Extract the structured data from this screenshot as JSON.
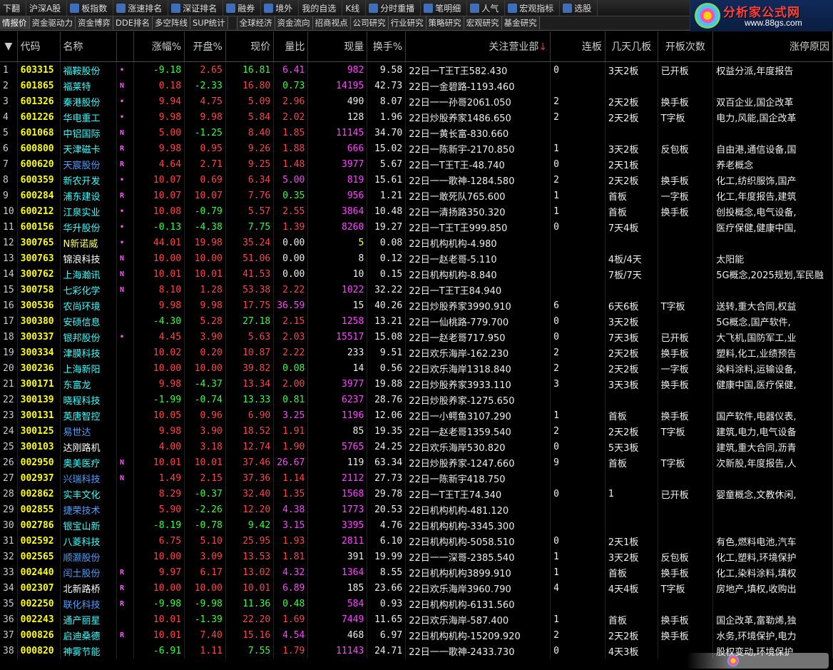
{
  "toolbar": {
    "items": [
      {
        "label": "下翻",
        "icon": ""
      },
      {
        "label": "沪深A股",
        "icon": ""
      },
      {
        "label": "板指数",
        "icon": "chart-icon"
      },
      {
        "label": "涨速排名",
        "icon": "speed-icon"
      },
      {
        "label": "深证排名",
        "icon": "rank-icon"
      },
      {
        "label": "融券",
        "icon": "r-icon"
      },
      {
        "label": "境外",
        "icon": "globe-icon"
      },
      {
        "label": "我的自选",
        "icon": ""
      },
      {
        "label": "K线",
        "icon": ""
      },
      {
        "label": "分时重播",
        "icon": "replay-icon"
      },
      {
        "label": "笔明细",
        "icon": "detail-icon"
      },
      {
        "label": "人气",
        "icon": "people-icon"
      },
      {
        "label": "宏观指标",
        "icon": "macro-icon"
      },
      {
        "label": "选股",
        "icon": "pick-icon"
      }
    ]
  },
  "brand": {
    "name": "分析家公式网",
    "url": "www.88gs.com"
  },
  "tabs": {
    "left": [
      "情报价",
      "资金驱动力",
      "资金博弈",
      "DDE排名",
      "多空阵线",
      "SUP统计"
    ],
    "right": [
      "全球经济",
      "资金流向",
      "招商视点",
      "公司研究",
      "行业研究",
      "策略研究",
      "宏观研究",
      "基金研究"
    ]
  },
  "table": {
    "headers": {
      "code": "代码",
      "name": "名称",
      "pct": "涨幅%",
      "open_pct": "开盘%",
      "price": "现价",
      "vol_ratio": "量比",
      "cur_vol": "现量",
      "turnover": "换手%",
      "broker": "关注营业部",
      "consec": "连板",
      "days": "几天几板",
      "open_times": "开板次数",
      "reason": "涨停原因"
    },
    "sort_marker": "↓",
    "rows": [
      {
        "idx": "1",
        "code": "603315",
        "name": "福鞍股份",
        "nc": "cyan",
        "flag": "•",
        "pct": "-9.18",
        "open_pct": "2.65",
        "price": "16.81",
        "vol_ratio": "6.41",
        "vr_c": "mag",
        "cur_vol": "982",
        "cv_c": "mag",
        "turnover": "9.58",
        "broker": "22日一T王T王582.430",
        "consec": "0",
        "days": "3天2板",
        "open_times": "已开板",
        "reason": "权益分派,年度报告"
      },
      {
        "idx": "2",
        "code": "601865",
        "name": "福莱特",
        "nc": "cyan",
        "flag": "N",
        "pct": "0.18",
        "open_pct": "-2.33",
        "price": "16.80",
        "vol_ratio": "0.73",
        "vr_c": "dn",
        "cur_vol": "14195",
        "cv_c": "mag",
        "turnover": "42.73",
        "broker": "22日一金碧路-1193.460",
        "consec": "",
        "days": "",
        "open_times": "",
        "reason": ""
      },
      {
        "idx": "3",
        "code": "601326",
        "name": "秦港股份",
        "nc": "cyan",
        "flag": "•",
        "pct": "9.94",
        "open_pct": "4.75",
        "price": "5.09",
        "vol_ratio": "2.96",
        "vr_c": "up",
        "cur_vol": "490",
        "cv_c": "wht",
        "turnover": "8.07",
        "broker": "22日一一孙哥2061.050",
        "consec": "2",
        "days": "2天2板",
        "open_times": "换手板",
        "reason": "双百企业,国企改革"
      },
      {
        "idx": "4",
        "code": "601226",
        "name": "华电重工",
        "nc": "cyan",
        "flag": "•",
        "pct": "9.98",
        "open_pct": "9.98",
        "price": "5.84",
        "vol_ratio": "2.02",
        "vr_c": "up",
        "cur_vol": "128",
        "cv_c": "wht",
        "turnover": "1.96",
        "broker": "22日炒股养家1486.650",
        "consec": "2",
        "days": "2天2板",
        "open_times": "T字板",
        "reason": "电力,风能,国企改革"
      },
      {
        "idx": "5",
        "code": "601068",
        "name": "中铝国际",
        "nc": "cyan",
        "flag": "N",
        "pct": "5.00",
        "open_pct": "-1.25",
        "price": "8.40",
        "vol_ratio": "1.85",
        "vr_c": "up",
        "cur_vol": "11145",
        "cv_c": "mag",
        "turnover": "34.70",
        "broker": "22日一黄长富-830.660",
        "consec": "",
        "days": "",
        "open_times": "",
        "reason": ""
      },
      {
        "idx": "6",
        "code": "600800",
        "name": "天津磁卡",
        "nc": "cyan",
        "flag": "R",
        "pct": "9.98",
        "open_pct": "0.95",
        "price": "9.26",
        "vol_ratio": "1.88",
        "vr_c": "up",
        "cur_vol": "666",
        "cv_c": "mag",
        "turnover": "15.02",
        "broker": "22日一陈新宇-2170.850",
        "consec": "1",
        "days": "3天2板",
        "open_times": "反包板",
        "reason": "自由港,通信设备,国"
      },
      {
        "idx": "7",
        "code": "600620",
        "name": "天宸股份",
        "nc": "blue",
        "flag": "R",
        "pct": "4.64",
        "open_pct": "2.71",
        "price": "9.25",
        "vol_ratio": "1.48",
        "vr_c": "up",
        "cur_vol": "3977",
        "cv_c": "mag",
        "turnover": "5.67",
        "broker": "22日一T王T王-48.740",
        "consec": "0",
        "days": "2天1板",
        "open_times": "",
        "reason": "养老概念"
      },
      {
        "idx": "8",
        "code": "600359",
        "name": "新农开发",
        "nc": "cyan",
        "flag": "•",
        "pct": "10.07",
        "open_pct": "0.69",
        "price": "6.34",
        "vol_ratio": "5.00",
        "vr_c": "mag",
        "cur_vol": "819",
        "cv_c": "mag",
        "turnover": "15.61",
        "broker": "22日一一歌神-1284.580",
        "consec": "2",
        "days": "2天2板",
        "open_times": "换手板",
        "reason": "化工,纺织服饰,国产"
      },
      {
        "idx": "9",
        "code": "600284",
        "name": "浦东建设",
        "nc": "cyan",
        "flag": "R",
        "pct": "10.07",
        "open_pct": "10.07",
        "price": "7.76",
        "vol_ratio": "0.35",
        "vr_c": "dn",
        "cur_vol": "956",
        "cv_c": "mag",
        "turnover": "1.21",
        "broker": "22日一敢死队765.600",
        "consec": "1",
        "days": "首板",
        "open_times": "一字板",
        "reason": "化工,年度报告,建筑"
      },
      {
        "idx": "10",
        "code": "600212",
        "name": "江泉实业",
        "nc": "cyan",
        "flag": "•",
        "pct": "10.08",
        "open_pct": "-0.79",
        "price": "5.57",
        "vol_ratio": "2.55",
        "vr_c": "up",
        "cur_vol": "3864",
        "cv_c": "mag",
        "turnover": "10.48",
        "broker": "22日一清扬路350.320",
        "consec": "1",
        "days": "首板",
        "open_times": "换手板",
        "reason": "创投概念,电气设备,"
      },
      {
        "idx": "11",
        "code": "600156",
        "name": "华升股份",
        "nc": "cyan",
        "flag": "•",
        "pct": "-0.13",
        "open_pct": "-4.38",
        "price": "7.75",
        "vol_ratio": "1.39",
        "vr_c": "up",
        "cur_vol": "8260",
        "cv_c": "mag",
        "turnover": "19.27",
        "broker": "22日一T王T王999.850",
        "consec": "0",
        "days": "7天4板",
        "open_times": "",
        "reason": "医疗保健,健康中国,"
      },
      {
        "idx": "12",
        "code": "300765",
        "name": "N新诺威",
        "nc": "yel",
        "flag": "•",
        "pct": "44.01",
        "open_pct": "19.98",
        "price": "35.24",
        "vol_ratio": "0.00",
        "vr_c": "wht",
        "cur_vol": "5",
        "cv_c": "yel",
        "turnover": "0.08",
        "broker": "22日机构机构-4.980",
        "consec": "",
        "days": "",
        "open_times": "",
        "reason": ""
      },
      {
        "idx": "13",
        "code": "300763",
        "name": "锦浪科技",
        "nc": "wht",
        "flag": "N",
        "pct": "10.00",
        "open_pct": "10.00",
        "price": "51.06",
        "vol_ratio": "0.00",
        "vr_c": "wht",
        "cur_vol": "8",
        "cv_c": "wht",
        "turnover": "0.12",
        "broker": "22日一赵老哥-5.110",
        "consec": "",
        "days": "4板/4天",
        "open_times": "",
        "reason": "太阳能"
      },
      {
        "idx": "14",
        "code": "300762",
        "name": "上海瀚讯",
        "nc": "cyan",
        "flag": "N",
        "pct": "10.01",
        "open_pct": "10.01",
        "price": "41.53",
        "vol_ratio": "0.00",
        "vr_c": "wht",
        "cur_vol": "10",
        "cv_c": "wht",
        "turnover": "0.15",
        "broker": "22日机构机构-8.840",
        "consec": "",
        "days": "7板/7天",
        "open_times": "",
        "reason": "5G概念,2025规划,军民融"
      },
      {
        "idx": "15",
        "code": "300758",
        "name": "七彩化学",
        "nc": "cyan",
        "flag": "N",
        "pct": "8.10",
        "open_pct": "1.28",
        "price": "53.38",
        "vol_ratio": "2.22",
        "vr_c": "up",
        "cur_vol": "1022",
        "cv_c": "mag",
        "turnover": "32.22",
        "broker": "22日一T王T王84.940",
        "consec": "",
        "days": "",
        "open_times": "",
        "reason": ""
      },
      {
        "idx": "16",
        "code": "300536",
        "name": "农尚环境",
        "nc": "cyan",
        "flag": "",
        "pct": "9.98",
        "open_pct": "9.98",
        "price": "17.75",
        "vol_ratio": "36.59",
        "vr_c": "mag",
        "cur_vol": "15",
        "cv_c": "wht",
        "turnover": "40.26",
        "broker": "22日炒股养家3990.910",
        "consec": "6",
        "days": "6天6板",
        "open_times": "T字板",
        "reason": "送转,重大合同,权益"
      },
      {
        "idx": "17",
        "code": "300380",
        "name": "安硕信息",
        "nc": "cyan",
        "flag": "",
        "pct": "-4.30",
        "open_pct": "5.28",
        "price": "27.18",
        "vol_ratio": "2.15",
        "vr_c": "up",
        "cur_vol": "1258",
        "cv_c": "mag",
        "turnover": "13.21",
        "broker": "22日一仙桃路-779.700",
        "consec": "0",
        "days": "3天2板",
        "open_times": "",
        "reason": "5G概念,国产软件,"
      },
      {
        "idx": "18",
        "code": "300337",
        "name": "银邦股份",
        "nc": "cyan",
        "flag": "•",
        "pct": "4.45",
        "open_pct": "3.90",
        "price": "5.63",
        "vol_ratio": "2.03",
        "vr_c": "up",
        "cur_vol": "15517",
        "cv_c": "mag",
        "turnover": "15.08",
        "broker": "22日一赵老哥717.950",
        "consec": "0",
        "days": "7天3板",
        "open_times": "已开板",
        "reason": "大飞机,国防军工,业"
      },
      {
        "idx": "19",
        "code": "300334",
        "name": "津膜科技",
        "nc": "cyan",
        "flag": "",
        "pct": "10.02",
        "open_pct": "0.20",
        "price": "10.87",
        "vol_ratio": "2.22",
        "vr_c": "up",
        "cur_vol": "233",
        "cv_c": "wht",
        "turnover": "9.51",
        "broker": "22日欢乐海岸-162.230",
        "consec": "2",
        "days": "2天2板",
        "open_times": "换手板",
        "reason": "塑料,化工,业绩预告"
      },
      {
        "idx": "20",
        "code": "300236",
        "name": "上海新阳",
        "nc": "cyan",
        "flag": "",
        "pct": "10.00",
        "open_pct": "10.00",
        "price": "39.82",
        "vol_ratio": "0.08",
        "vr_c": "dn",
        "cur_vol": "14",
        "cv_c": "wht",
        "turnover": "0.56",
        "broker": "22日欢乐海岸1318.840",
        "consec": "2",
        "days": "2天2板",
        "open_times": "一字板",
        "reason": "染料涂料,运输设备,"
      },
      {
        "idx": "21",
        "code": "300171",
        "name": "东富龙",
        "nc": "cyan",
        "flag": "",
        "pct": "9.98",
        "open_pct": "-4.37",
        "price": "13.34",
        "vol_ratio": "2.00",
        "vr_c": "up",
        "cur_vol": "3977",
        "cv_c": "mag",
        "turnover": "19.88",
        "broker": "22日炒股养家3933.110",
        "consec": "3",
        "days": "3天3板",
        "open_times": "换手板",
        "reason": "健康中国,医疗保健,"
      },
      {
        "idx": "22",
        "code": "300139",
        "name": "晓程科技",
        "nc": "cyan",
        "flag": "",
        "pct": "-1.99",
        "open_pct": "-0.74",
        "price": "13.33",
        "vol_ratio": "0.81",
        "vr_c": "dn",
        "cur_vol": "6237",
        "cv_c": "mag",
        "turnover": "28.76",
        "broker": "22日炒股养家-1275.650",
        "consec": "",
        "days": "",
        "open_times": "",
        "reason": ""
      },
      {
        "idx": "23",
        "code": "300131",
        "name": "英唐智控",
        "nc": "cyan",
        "flag": "",
        "pct": "10.05",
        "open_pct": "0.96",
        "price": "6.90",
        "vol_ratio": "3.25",
        "vr_c": "mag",
        "cur_vol": "1196",
        "cv_c": "mag",
        "turnover": "12.06",
        "broker": "22日一小鳄鱼3107.290",
        "consec": "1",
        "days": "首板",
        "open_times": "换手板",
        "reason": "国产软件,电器仪表,"
      },
      {
        "idx": "24",
        "code": "300125",
        "name": "易世达",
        "nc": "blue",
        "flag": "",
        "pct": "9.98",
        "open_pct": "3.90",
        "price": "18.52",
        "vol_ratio": "1.91",
        "vr_c": "up",
        "cur_vol": "85",
        "cv_c": "wht",
        "turnover": "19.35",
        "broker": "22日一赵老哥1359.540",
        "consec": "2",
        "days": "2天2板",
        "open_times": "T字板",
        "reason": "建筑,电力,电气设备"
      },
      {
        "idx": "25",
        "code": "300103",
        "name": "达刚路机",
        "nc": "wht",
        "flag": "",
        "pct": "4.00",
        "open_pct": "3.18",
        "price": "12.74",
        "vol_ratio": "1.90",
        "vr_c": "up",
        "cur_vol": "5765",
        "cv_c": "mag",
        "turnover": "24.25",
        "broker": "22日欢乐海岸530.820",
        "consec": "0",
        "days": "5天3板",
        "open_times": "",
        "reason": "建筑,重大合同,沥青"
      },
      {
        "idx": "26",
        "code": "002950",
        "name": "奥美医疗",
        "nc": "cyan",
        "flag": "N",
        "pct": "10.01",
        "open_pct": "10.01",
        "price": "37.46",
        "vol_ratio": "26.67",
        "vr_c": "mag",
        "cur_vol": "119",
        "cv_c": "wht",
        "turnover": "63.34",
        "broker": "22日炒股养家-1247.660",
        "consec": "9",
        "days": "首板",
        "open_times": "T字板",
        "reason": "次新股,年度报告,人"
      },
      {
        "idx": "27",
        "code": "002937",
        "name": "兴瑞科技",
        "nc": "blue",
        "flag": "N",
        "pct": "1.49",
        "open_pct": "2.15",
        "price": "37.36",
        "vol_ratio": "1.14",
        "vr_c": "up",
        "cur_vol": "2112",
        "cv_c": "mag",
        "turnover": "27.73",
        "broker": "22日一陈新宇418.750",
        "consec": "",
        "days": "",
        "open_times": "",
        "reason": ""
      },
      {
        "idx": "28",
        "code": "002862",
        "name": "实丰文化",
        "nc": "cyan",
        "flag": "",
        "pct": "8.29",
        "open_pct": "-0.37",
        "price": "32.40",
        "vol_ratio": "1.35",
        "vr_c": "up",
        "cur_vol": "1568",
        "cv_c": "mag",
        "turnover": "29.78",
        "broker": "22日一T王T王74.340",
        "consec": "0",
        "days": "1",
        "open_times": "已开板",
        "reason": "婴童概念,文教休闲,"
      },
      {
        "idx": "29",
        "code": "002855",
        "name": "捷荣技术",
        "nc": "blue",
        "flag": "",
        "pct": "5.90",
        "open_pct": "-2.26",
        "price": "12.20",
        "vol_ratio": "4.38",
        "vr_c": "mag",
        "cur_vol": "1773",
        "cv_c": "mag",
        "turnover": "20.53",
        "broker": "22日机构机构-481.120",
        "consec": "",
        "days": "",
        "open_times": "",
        "reason": ""
      },
      {
        "idx": "30",
        "code": "002786",
        "name": "银宝山新",
        "nc": "cyan",
        "flag": "",
        "pct": "-8.19",
        "open_pct": "-0.78",
        "price": "9.42",
        "vol_ratio": "3.15",
        "vr_c": "mag",
        "cur_vol": "3395",
        "cv_c": "mag",
        "turnover": "4.76",
        "broker": "22日机构机构-3345.300",
        "consec": "",
        "days": "",
        "open_times": "",
        "reason": ""
      },
      {
        "idx": "31",
        "code": "002592",
        "name": "八菱科技",
        "nc": "cyan",
        "flag": "",
        "pct": "6.75",
        "open_pct": "5.10",
        "price": "25.95",
        "vol_ratio": "1.93",
        "vr_c": "up",
        "cur_vol": "2811",
        "cv_c": "mag",
        "turnover": "6.10",
        "broker": "22日机构机构-5058.510",
        "consec": "0",
        "days": "2天1板",
        "open_times": "",
        "reason": "有色,燃料电池,汽车"
      },
      {
        "idx": "32",
        "code": "002565",
        "name": "顺灏股份",
        "nc": "blue",
        "flag": "",
        "pct": "10.00",
        "open_pct": "3.09",
        "price": "13.53",
        "vol_ratio": "1.81",
        "vr_c": "up",
        "cur_vol": "391",
        "cv_c": "wht",
        "turnover": "19.99",
        "broker": "22日一一深哥-2385.540",
        "consec": "1",
        "days": "3天2板",
        "open_times": "反包板",
        "reason": "化工,塑料,环境保护"
      },
      {
        "idx": "33",
        "code": "002440",
        "name": "闰土股份",
        "nc": "blue",
        "flag": "R",
        "pct": "9.97",
        "open_pct": "6.17",
        "price": "13.02",
        "vol_ratio": "4.32",
        "vr_c": "mag",
        "cur_vol": "1364",
        "cv_c": "mag",
        "turnover": "8.55",
        "broker": "22日机构机构3899.910",
        "consec": "1",
        "days": "首板",
        "open_times": "换手板",
        "reason": "化工,染料涂料,填权"
      },
      {
        "idx": "34",
        "code": "002307",
        "name": "北新路桥",
        "nc": "wht",
        "flag": "R",
        "pct": "10.00",
        "open_pct": "10.00",
        "price": "10.01",
        "vol_ratio": "6.89",
        "vr_c": "mag",
        "cur_vol": "185",
        "cv_c": "wht",
        "turnover": "23.66",
        "broker": "22日欢乐海岸3960.790",
        "consec": "4",
        "days": "4天4板",
        "open_times": "T字板",
        "reason": "房地产,填权,收购出"
      },
      {
        "idx": "35",
        "code": "002250",
        "name": "联化科技",
        "nc": "blue",
        "flag": "R",
        "pct": "-9.98",
        "open_pct": "-9.98",
        "price": "11.36",
        "vol_ratio": "0.48",
        "vr_c": "dn",
        "cur_vol": "584",
        "cv_c": "mag",
        "turnover": "0.93",
        "broker": "22日机构机构-6131.560",
        "consec": "",
        "days": "",
        "open_times": "",
        "reason": ""
      },
      {
        "idx": "36",
        "code": "002243",
        "name": "通产丽星",
        "nc": "cyan",
        "flag": "",
        "pct": "10.01",
        "open_pct": "-1.39",
        "price": "22.20",
        "vol_ratio": "1.69",
        "vr_c": "up",
        "cur_vol": "7449",
        "cv_c": "mag",
        "turnover": "11.65",
        "broker": "22日欢乐海岸-587.400",
        "consec": "1",
        "days": "首板",
        "open_times": "换手板",
        "reason": "国企改革,富勒烯,独"
      },
      {
        "idx": "37",
        "code": "000826",
        "name": "启迪桑德",
        "nc": "cyan",
        "flag": "R",
        "pct": "10.01",
        "open_pct": "7.40",
        "price": "15.16",
        "vol_ratio": "4.54",
        "vr_c": "mag",
        "cur_vol": "468",
        "cv_c": "wht",
        "turnover": "6.97",
        "broker": "22日机构机构-15209.920",
        "consec": "2",
        "days": "2天2板",
        "open_times": "换手板",
        "reason": "水务,环境保护,电力"
      },
      {
        "idx": "38",
        "code": "000820",
        "name": "神雾节能",
        "nc": "cyan",
        "flag": "",
        "pct": "-6.91",
        "open_pct": "1.11",
        "price": "7.55",
        "vol_ratio": "1.79",
        "vr_c": "up",
        "cur_vol": "11143",
        "cv_c": "mag",
        "turnover": "24.71",
        "broker": "22日一一歌神-2433.730",
        "consec": "0",
        "days": "4天3板",
        "open_times": "",
        "reason": "股权变动,环境保护"
      }
    ]
  },
  "colors": {
    "up": "#ff4444",
    "down": "#33ff33",
    "magenta": "#ff44ff",
    "code": "#ffff00",
    "name": "#33ffff"
  }
}
